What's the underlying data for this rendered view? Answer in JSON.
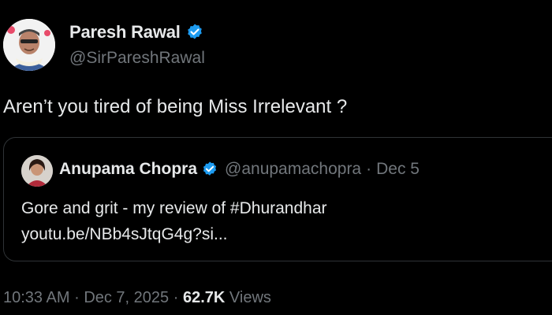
{
  "author": {
    "name": "Paresh Rawal",
    "handle": "@SirPareshRawal",
    "verified_icon": "verified-badge-icon"
  },
  "tweet": {
    "text": "Aren’t you tired of being Miss Irrelevant ?"
  },
  "quoted": {
    "name": "Anupama Chopra",
    "handle": "@anupamachopra",
    "separator": "·",
    "date": "Dec 5",
    "line1": "Gore and grit - my review of #Dhurandhar",
    "line2": "youtu.be/NBb4sJtqG4g?si..."
  },
  "meta": {
    "time": "10:33 AM",
    "separator": "·",
    "date": "Dec 7, 2025",
    "views_count": "62.7K",
    "views_label": "Views"
  },
  "colors": {
    "background": "#000000",
    "text": "#e7e9ea",
    "muted": "#71767b",
    "verified": "#1d9bf0",
    "border": "#2f3336"
  }
}
